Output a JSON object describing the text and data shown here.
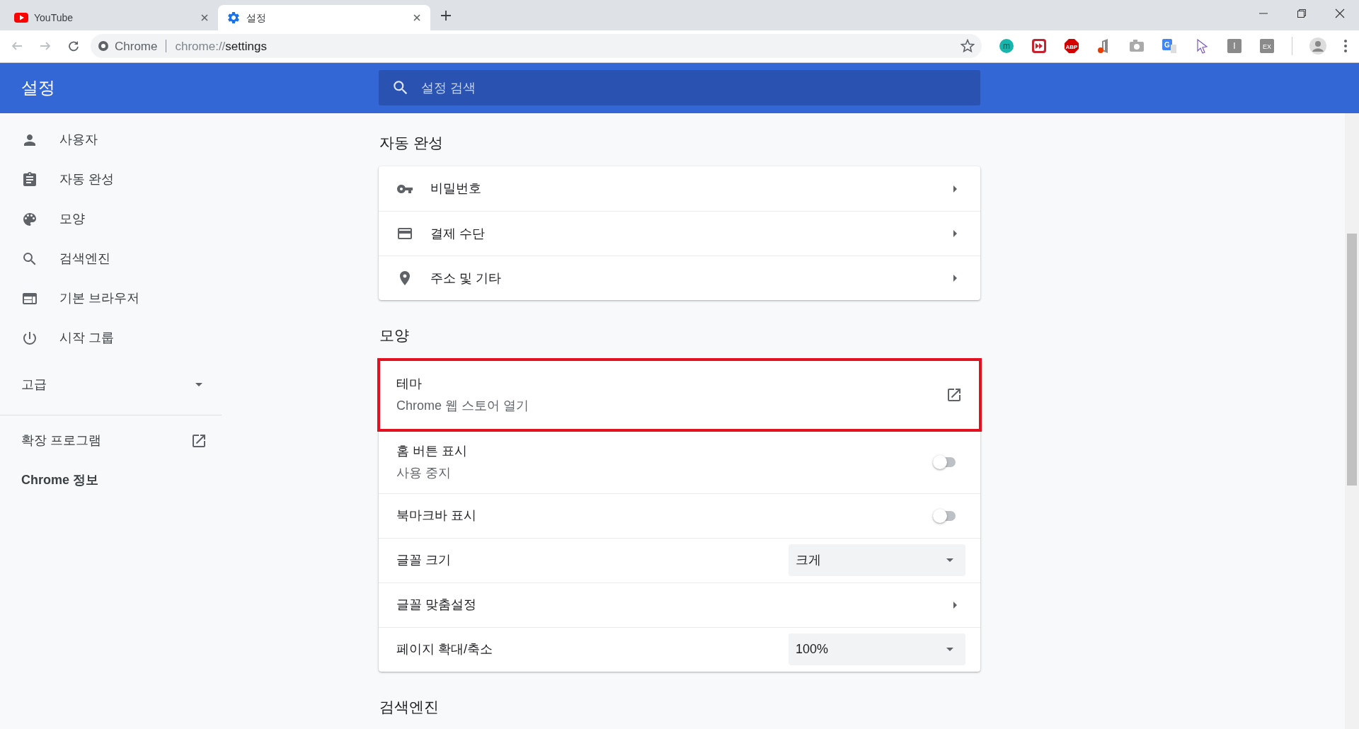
{
  "tabs": [
    {
      "title": "YouTube",
      "kind": "youtube",
      "selected": false
    },
    {
      "title": "설정",
      "kind": "settings",
      "selected": true
    }
  ],
  "address": {
    "origin": "Chrome",
    "scheme": "chrome://",
    "path": "settings"
  },
  "extensions": [
    {
      "kind": "m",
      "text": "m"
    },
    {
      "kind": "forward"
    },
    {
      "kind": "abp",
      "text": "ABP"
    },
    {
      "kind": "office"
    },
    {
      "kind": "camera"
    },
    {
      "kind": "translate",
      "text": "G"
    },
    {
      "kind": "cursor"
    },
    {
      "kind": "grey",
      "text": "I"
    },
    {
      "kind": "grey",
      "text": "EX"
    }
  ],
  "header": {
    "title": "설정",
    "search": {
      "placeholder": "설정 검색"
    }
  },
  "sidebar": {
    "items": [
      {
        "kind": "person",
        "label": "사용자",
        "selected": false
      },
      {
        "kind": "assignment",
        "label": "자동 완성",
        "selected": false
      },
      {
        "kind": "palette",
        "label": "모양",
        "selected": false
      },
      {
        "kind": "search",
        "label": "검색엔진",
        "selected": false
      },
      {
        "kind": "browser",
        "label": "기본 브라우저",
        "selected": false
      },
      {
        "kind": "power",
        "label": "시작 그룹",
        "selected": false
      }
    ],
    "advanced": {
      "label": "고급",
      "expanded": false
    },
    "links": [
      {
        "label": "확장 프로그램",
        "external": true
      },
      {
        "label": "Chrome 정보",
        "external": false
      }
    ]
  },
  "sections": [
    {
      "title": "자동 완성",
      "rows": [
        {
          "kind": "link",
          "label": "비밀번호"
        },
        {
          "kind": "link",
          "label": "결제 수단"
        },
        {
          "kind": "link",
          "label": "주소 및 기타"
        }
      ]
    },
    {
      "title": "모양",
      "rows": [
        {
          "kind": "external",
          "label": "테마",
          "sublabel": "Chrome 웹 스토어 열기",
          "highlighted": true
        },
        {
          "kind": "toggle",
          "label": "홈 버튼 표시",
          "sublabel": "사용 중지",
          "on": false
        },
        {
          "kind": "toggle",
          "label": "북마크바 표시",
          "on": false
        },
        {
          "kind": "select",
          "label": "글꼴 크기",
          "value": "크게"
        },
        {
          "kind": "link",
          "label": "글꼴 맞춤설정"
        },
        {
          "kind": "select",
          "label": "페이지 확대/축소",
          "value": "100%"
        }
      ]
    },
    {
      "title": "검색엔진"
    }
  ]
}
